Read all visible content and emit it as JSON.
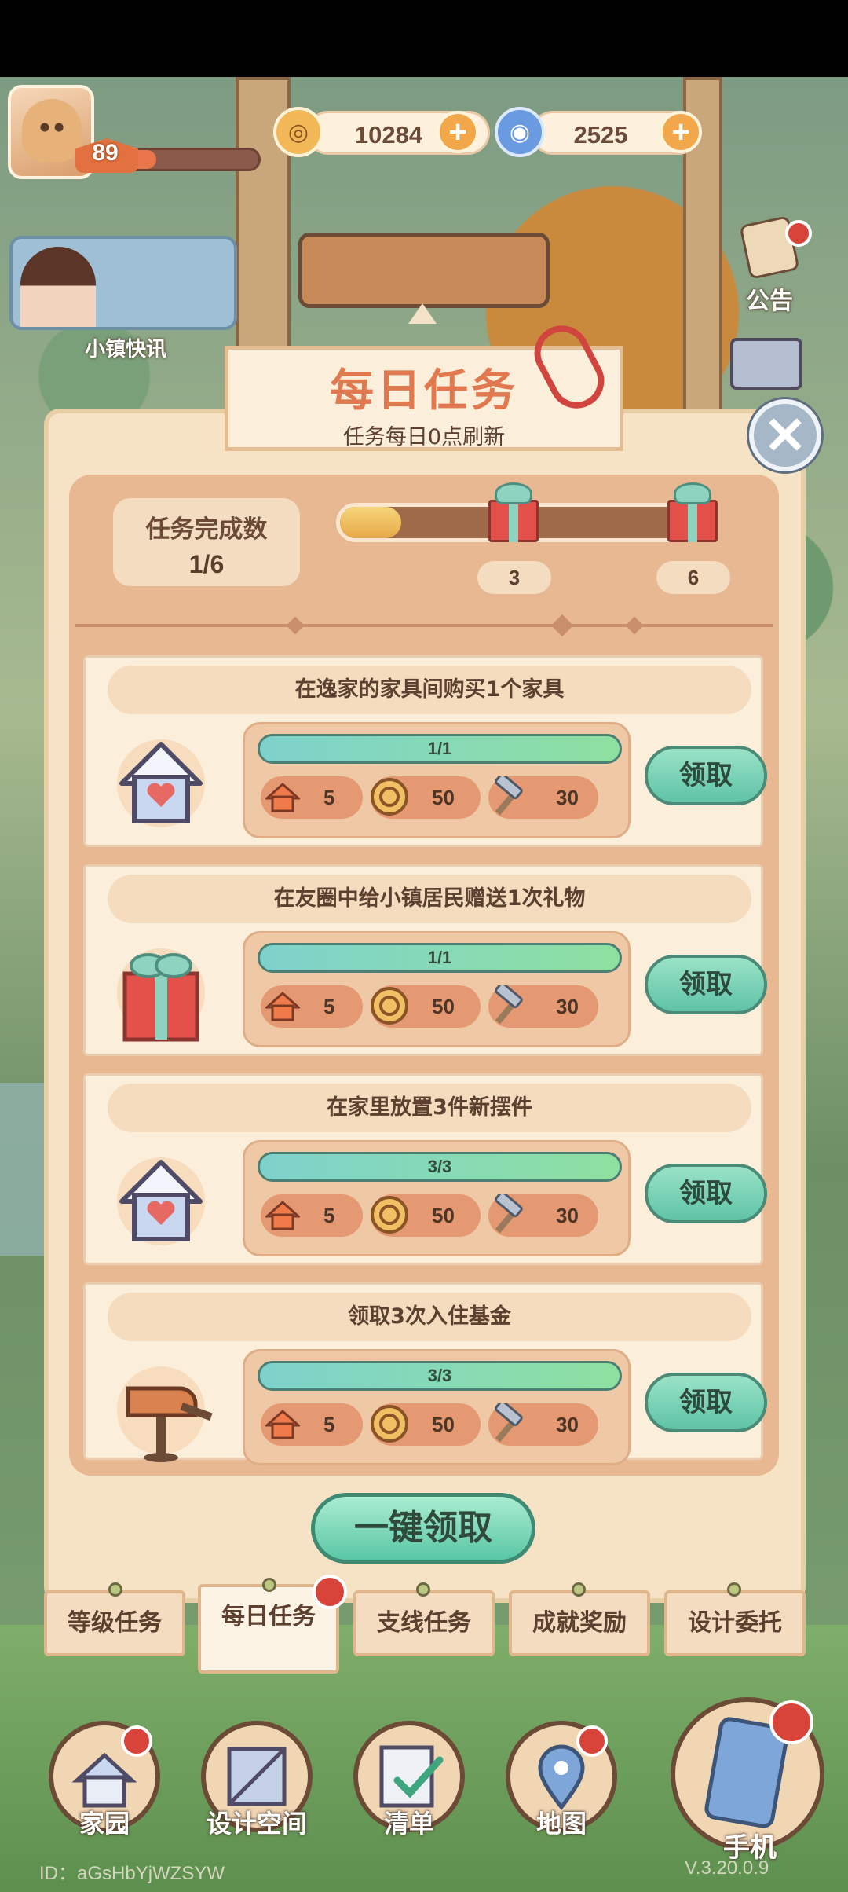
{
  "hud": {
    "level": "89",
    "xp_fraction": 0.25,
    "coins": "10284",
    "gems": "2525",
    "plus": "+",
    "news_label": "小镇快讯",
    "notice_label": "公告"
  },
  "modal": {
    "title": "每日任务",
    "subtitle": "任务每日0点刷新",
    "close_symbol": "✕",
    "completed_label": "任务完成数",
    "completed_value": "1/6",
    "progress_fraction": 0.1667,
    "milestones": [
      "3",
      "6"
    ],
    "claim_all": "一键领取"
  },
  "tasks": [
    {
      "title": "在逸家的家具间购买1个家具",
      "progress": "1/1",
      "icon": "house-heart-icon",
      "rewards": [
        "5",
        "50",
        "30"
      ],
      "claim": "领取"
    },
    {
      "title": "在友圈中给小镇居民赠送1次礼物",
      "progress": "1/1",
      "icon": "gift-icon",
      "rewards": [
        "5",
        "50",
        "30"
      ],
      "claim": "领取"
    },
    {
      "title": "在家里放置3件新摆件",
      "progress": "3/3",
      "icon": "house-heart-icon",
      "rewards": [
        "5",
        "50",
        "30"
      ],
      "claim": "领取"
    },
    {
      "title": "领取3次入住基金",
      "progress": "3/3",
      "icon": "mailbox-icon",
      "rewards": [
        "5",
        "50",
        "30"
      ],
      "claim": "领取"
    }
  ],
  "tabs": [
    "等级任务",
    "每日任务",
    "支线任务",
    "成就奖励",
    "设计委托"
  ],
  "dock": [
    "家园",
    "设计空间",
    "清单",
    "地图",
    "手机"
  ],
  "footer": {
    "user_id": "ID：aGsHbYjWZSYW",
    "version": "V.3.20.0.9"
  },
  "colors": {
    "accent_title": "#e0794f",
    "claim_green": "#5fc3a6",
    "red_dot": "#d9443a"
  }
}
